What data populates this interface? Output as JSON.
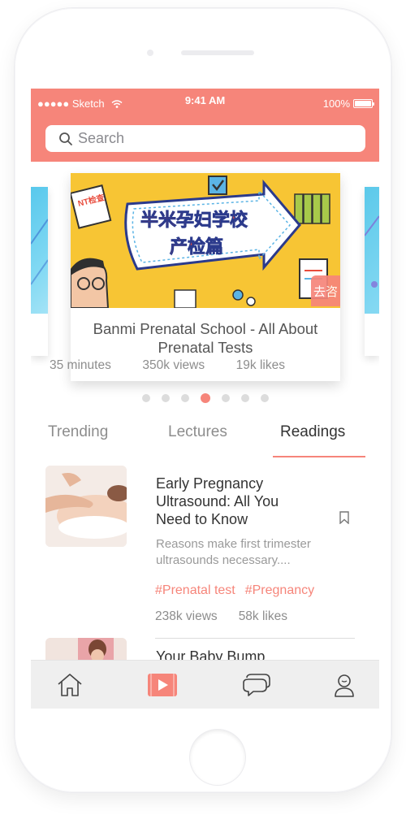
{
  "status_bar": {
    "carrier": "●●●●● Sketch",
    "time": "9:41 AM",
    "battery": "100%",
    "battery_level": 1.0
  },
  "search": {
    "placeholder": "Search"
  },
  "carousel": {
    "featured": {
      "title": "Banmi Prenatal School - All About Prenatal Tests",
      "duration": "35 minutes",
      "views": "350k views",
      "likes": "19k likes",
      "badge": "去咨",
      "poster_title_line1": "半米孕妇学校",
      "poster_title_line2": "产检篇",
      "poster_tag": "NT检查"
    },
    "page_count": 7,
    "active_page": 4
  },
  "tabs": [
    {
      "label": "Trending",
      "active": false
    },
    {
      "label": "Lectures",
      "active": false
    },
    {
      "label": "Readings",
      "active": true
    }
  ],
  "articles": [
    {
      "title": "Early Pregnancy Ultrasound: All You Need to Know",
      "summary": "Reasons make first trimester ultrasounds necessary....",
      "tags": [
        "#Prenatal test",
        "#Pregnancy"
      ],
      "views": "238k views",
      "likes": "58k likes"
    },
    {
      "title": "Your Baby Bump"
    }
  ],
  "tabbar": {
    "items": [
      {
        "icon": "home-icon",
        "active": false
      },
      {
        "icon": "video-play-icon",
        "active": true
      },
      {
        "icon": "chat-bubbles-icon",
        "active": false
      },
      {
        "icon": "profile-icon",
        "active": false
      }
    ]
  },
  "colors": {
    "accent": "#f6857a",
    "poster_yellow": "#f7c534",
    "text_primary": "#333333",
    "text_secondary": "#8d8d8d"
  }
}
